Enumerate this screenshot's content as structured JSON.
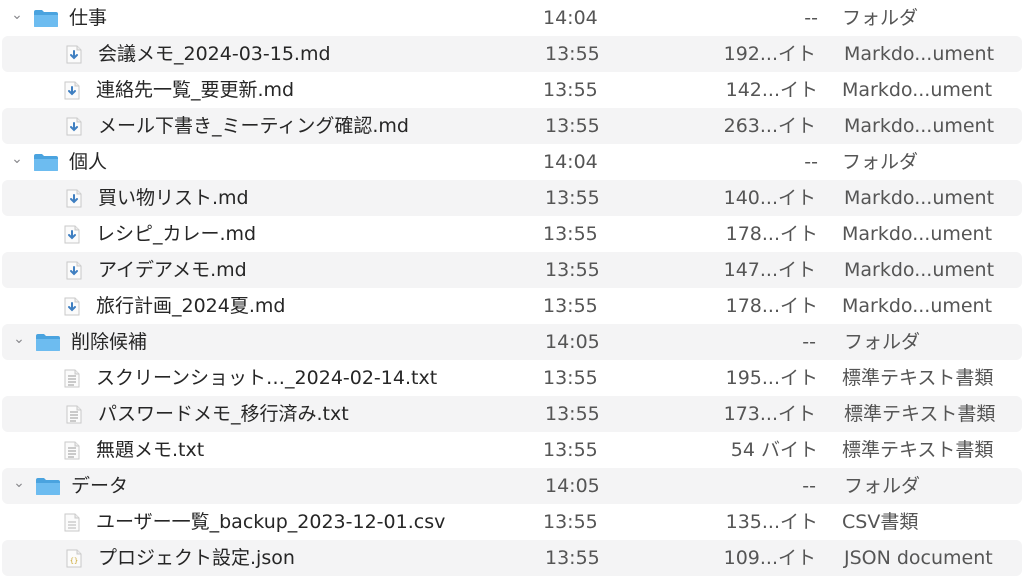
{
  "rows": [
    {
      "type": "folder",
      "name": "仕事",
      "time": "14:04",
      "size": "--",
      "kind": "フォルダ"
    },
    {
      "type": "md",
      "name": "会議メモ_2024-03-15.md",
      "time": "13:55",
      "size": "192...イト",
      "kind": "Markdo...ument"
    },
    {
      "type": "md",
      "name": "連絡先一覧_要更新.md",
      "time": "13:55",
      "size": "142...イト",
      "kind": "Markdo...ument"
    },
    {
      "type": "md",
      "name": "メール下書き_ミーティング確認.md",
      "time": "13:55",
      "size": "263...イト",
      "kind": "Markdo...ument"
    },
    {
      "type": "folder",
      "name": "個人",
      "time": "14:04",
      "size": "--",
      "kind": "フォルダ"
    },
    {
      "type": "md",
      "name": "買い物リスト.md",
      "time": "13:55",
      "size": "140...イト",
      "kind": "Markdo...ument"
    },
    {
      "type": "md",
      "name": "レシピ_カレー.md",
      "time": "13:55",
      "size": "178...イト",
      "kind": "Markdo...ument"
    },
    {
      "type": "md",
      "name": "アイデアメモ.md",
      "time": "13:55",
      "size": "147...イト",
      "kind": "Markdo...ument"
    },
    {
      "type": "md",
      "name": "旅行計画_2024夏.md",
      "time": "13:55",
      "size": "178...イト",
      "kind": "Markdo...ument"
    },
    {
      "type": "folder",
      "name": "削除候補",
      "time": "14:05",
      "size": "--",
      "kind": "フォルダ"
    },
    {
      "type": "txt",
      "name": "スクリーンショット…_2024-02-14.txt",
      "time": "13:55",
      "size": "195...イト",
      "kind": "標準テキスト書類"
    },
    {
      "type": "txt",
      "name": "パスワードメモ_移行済み.txt",
      "time": "13:55",
      "size": "173...イト",
      "kind": "標準テキスト書類"
    },
    {
      "type": "txt",
      "name": "無題メモ.txt",
      "time": "13:55",
      "size": "54 バイト",
      "kind": "標準テキスト書類"
    },
    {
      "type": "folder",
      "name": "データ",
      "time": "14:05",
      "size": "--",
      "kind": "フォルダ"
    },
    {
      "type": "csv",
      "name": "ユーザー一覧_backup_2023-12-01.csv",
      "time": "13:55",
      "size": "135...イト",
      "kind": "CSV書類"
    },
    {
      "type": "json",
      "name": "プロジェクト設定.json",
      "time": "13:55",
      "size": "109...イト",
      "kind": "JSON document"
    }
  ],
  "colors": {
    "folder": "#5fb2ea",
    "row_alt": "#f4f4f5",
    "md_arrow": "#3f7fc1"
  }
}
